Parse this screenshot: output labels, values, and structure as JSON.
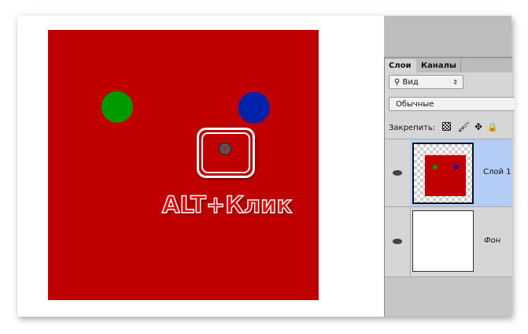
{
  "annotation": {
    "text": "ALT+Клик"
  },
  "colors": {
    "canvas_red": "#c00000",
    "green_dot": "#009900",
    "blue_dot": "#0022aa",
    "selected_layer": "#b4cdf6"
  },
  "panel": {
    "tabs": [
      {
        "label": "Слои",
        "active": true
      },
      {
        "label": "Каналы",
        "active": false
      }
    ],
    "filter": {
      "icon": "search-icon",
      "value": "Вид"
    },
    "blend_mode": "Обычные",
    "lock_label": "Закрепить:",
    "lock_icons": [
      "transparency-lock-icon",
      "brush-icon",
      "move-icon",
      "lock-icon"
    ],
    "layers": [
      {
        "name": "Слой 1",
        "selected": true,
        "visible": true
      },
      {
        "name": "Фон",
        "selected": false,
        "visible": true
      }
    ]
  }
}
